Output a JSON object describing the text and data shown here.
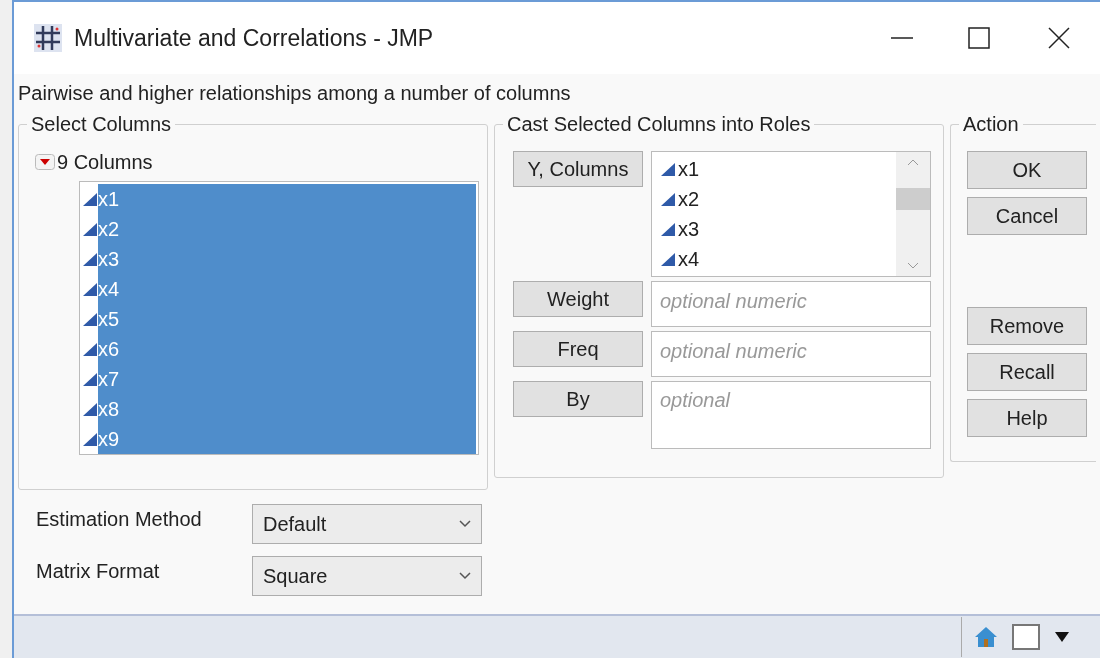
{
  "window": {
    "title": "Multivariate and Correlations - JMP"
  },
  "description": "Pairwise and higher relationships among a number of columns",
  "select_columns": {
    "title": "Select Columns",
    "header": "9 Columns",
    "expanded": true,
    "columns": [
      {
        "name": "x1",
        "selected": true
      },
      {
        "name": "x2",
        "selected": true
      },
      {
        "name": "x3",
        "selected": true
      },
      {
        "name": "x4",
        "selected": true
      },
      {
        "name": "x5",
        "selected": true
      },
      {
        "name": "x6",
        "selected": true
      },
      {
        "name": "x7",
        "selected": true
      },
      {
        "name": "x8",
        "selected": true
      },
      {
        "name": "x9",
        "selected": true
      }
    ]
  },
  "roles": {
    "title": "Cast Selected Columns into Roles",
    "items": [
      {
        "label": "Y, Columns",
        "kind": "list",
        "columns": [
          "x1",
          "x2",
          "x3",
          "x4"
        ]
      },
      {
        "label": "Weight",
        "kind": "field",
        "placeholder": "optional numeric"
      },
      {
        "label": "Freq",
        "kind": "field",
        "placeholder": "optional numeric"
      },
      {
        "label": "By",
        "kind": "tall",
        "placeholder": "optional"
      }
    ]
  },
  "action": {
    "title": "Action",
    "groups": [
      [
        "OK",
        "Cancel"
      ],
      [
        "Remove",
        "Recall",
        "Help"
      ]
    ]
  },
  "options": [
    {
      "label": "Estimation Method",
      "value": "Default"
    },
    {
      "label": "Matrix Format",
      "value": "Square"
    }
  ]
}
